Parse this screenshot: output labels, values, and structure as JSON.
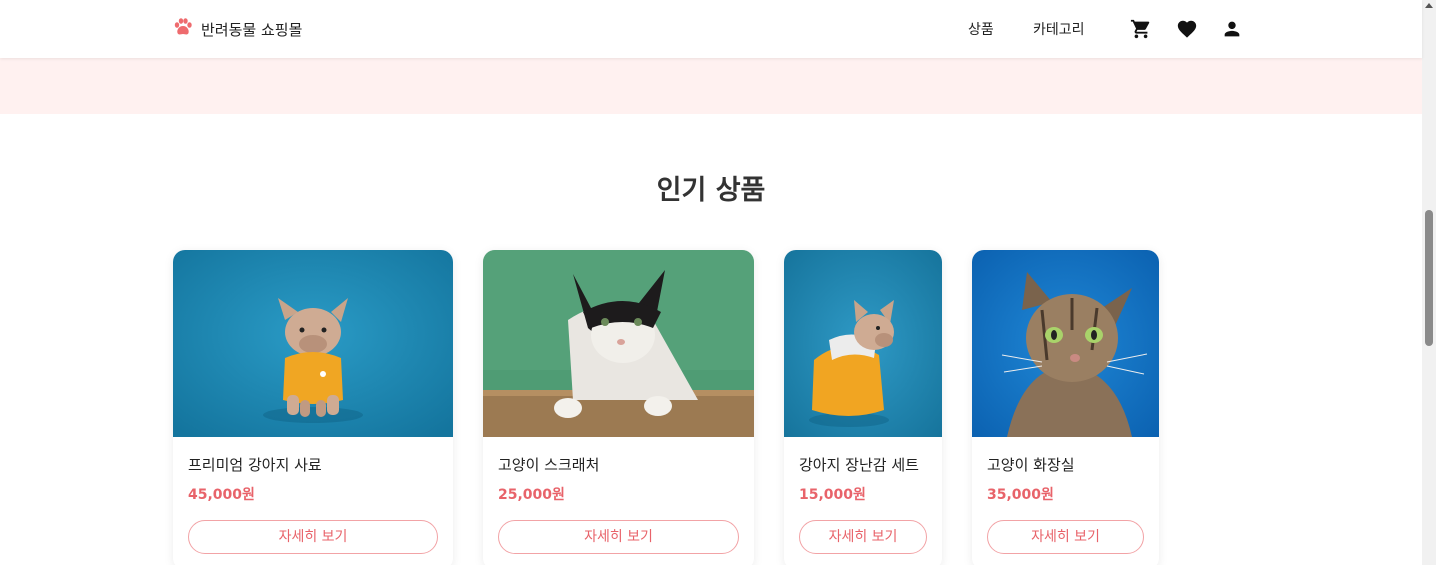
{
  "header": {
    "brand": "반려동물 쇼핑몰",
    "logo_icon": "paw-icon",
    "nav": [
      "상품",
      "카테고리"
    ],
    "icons": [
      "cart-icon",
      "heart-icon",
      "user-icon"
    ]
  },
  "section": {
    "title": "인기 상품"
  },
  "products": [
    {
      "name": "프리미엄 강아지 사료",
      "price": "45,000원",
      "button": "자세히 보기",
      "image": "french-bulldog-yellow-shirt"
    },
    {
      "name": "고양이 스크래처",
      "price": "25,000원",
      "button": "자세히 보기",
      "image": "black-white-cat-on-box"
    },
    {
      "name": "강아지 장난감 세트",
      "price": "15,000원",
      "button": "자세히 보기",
      "image": "french-bulldog-yellow-hoodie"
    },
    {
      "name": "고양이 화장실",
      "price": "35,000원",
      "button": "자세히 보기",
      "image": "tabby-cat-blue-background"
    }
  ],
  "colors": {
    "accent": "#e8636a",
    "hero_band": "#fff1f0",
    "button_border": "#f2a3a6"
  }
}
